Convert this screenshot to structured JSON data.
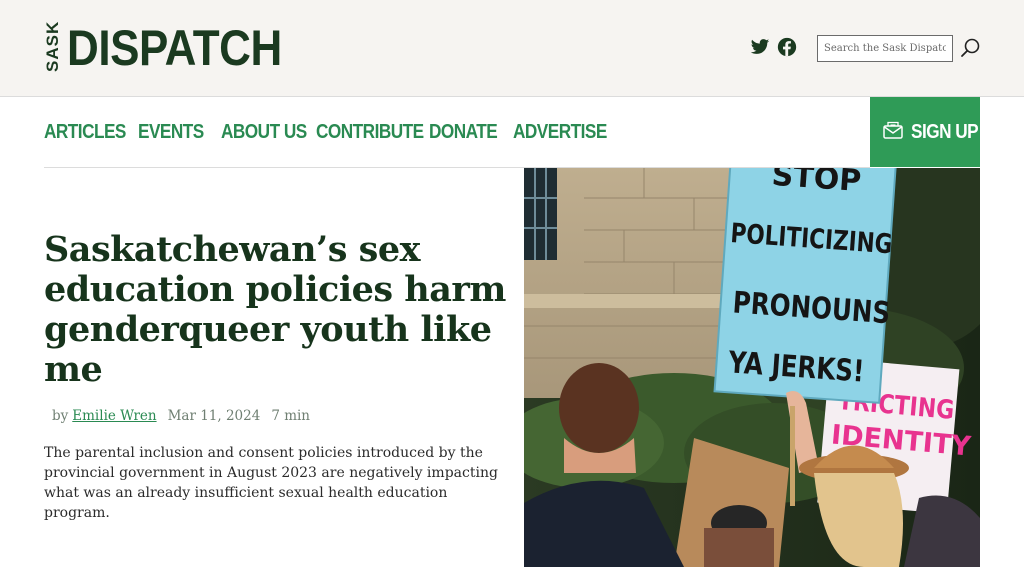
{
  "site": {
    "logo_small": "SASK",
    "logo_big": "DISPATCH"
  },
  "header": {
    "social": [
      {
        "name": "twitter-icon"
      },
      {
        "name": "facebook-icon"
      }
    ],
    "search": {
      "placeholder": "Search the Sask Dispatch",
      "value": ""
    }
  },
  "nav": {
    "items": [
      {
        "label": "ARTICLES"
      },
      {
        "label": "EVENTS"
      },
      {
        "label": "ABOUT US"
      },
      {
        "label": "CONTRIBUTE"
      },
      {
        "label": "DONATE"
      },
      {
        "label": "ADVERTISE"
      }
    ],
    "signup_label": "SIGN UP"
  },
  "article": {
    "headline": "Saskatchewan’s sex education policies harm genderqueer youth like me",
    "byline": {
      "prefix": "by",
      "author": "Emilie Wren",
      "date": "Mar 11, 2024",
      "read_time": "7 min"
    },
    "summary": "The parental inclusion and consent policies introduced by the provincial government in August 2023 are negatively impacting what was an already insufficient sexual health education program.",
    "image_signs": {
      "sign1": [
        "STOP",
        "POLITICIZING",
        "PRONOUNS",
        "YA JERKS!"
      ],
      "sign2": [
        "RESTRICTING",
        "IDENTITY"
      ]
    }
  },
  "colors": {
    "brand_dark": "#1b3a20",
    "brand_green": "#2a8a52",
    "signup_bg": "#2f9b57",
    "header_bg": "#f6f4f1",
    "sign_pink": "#e8338f",
    "sign_blue": "#8ed3e6"
  }
}
